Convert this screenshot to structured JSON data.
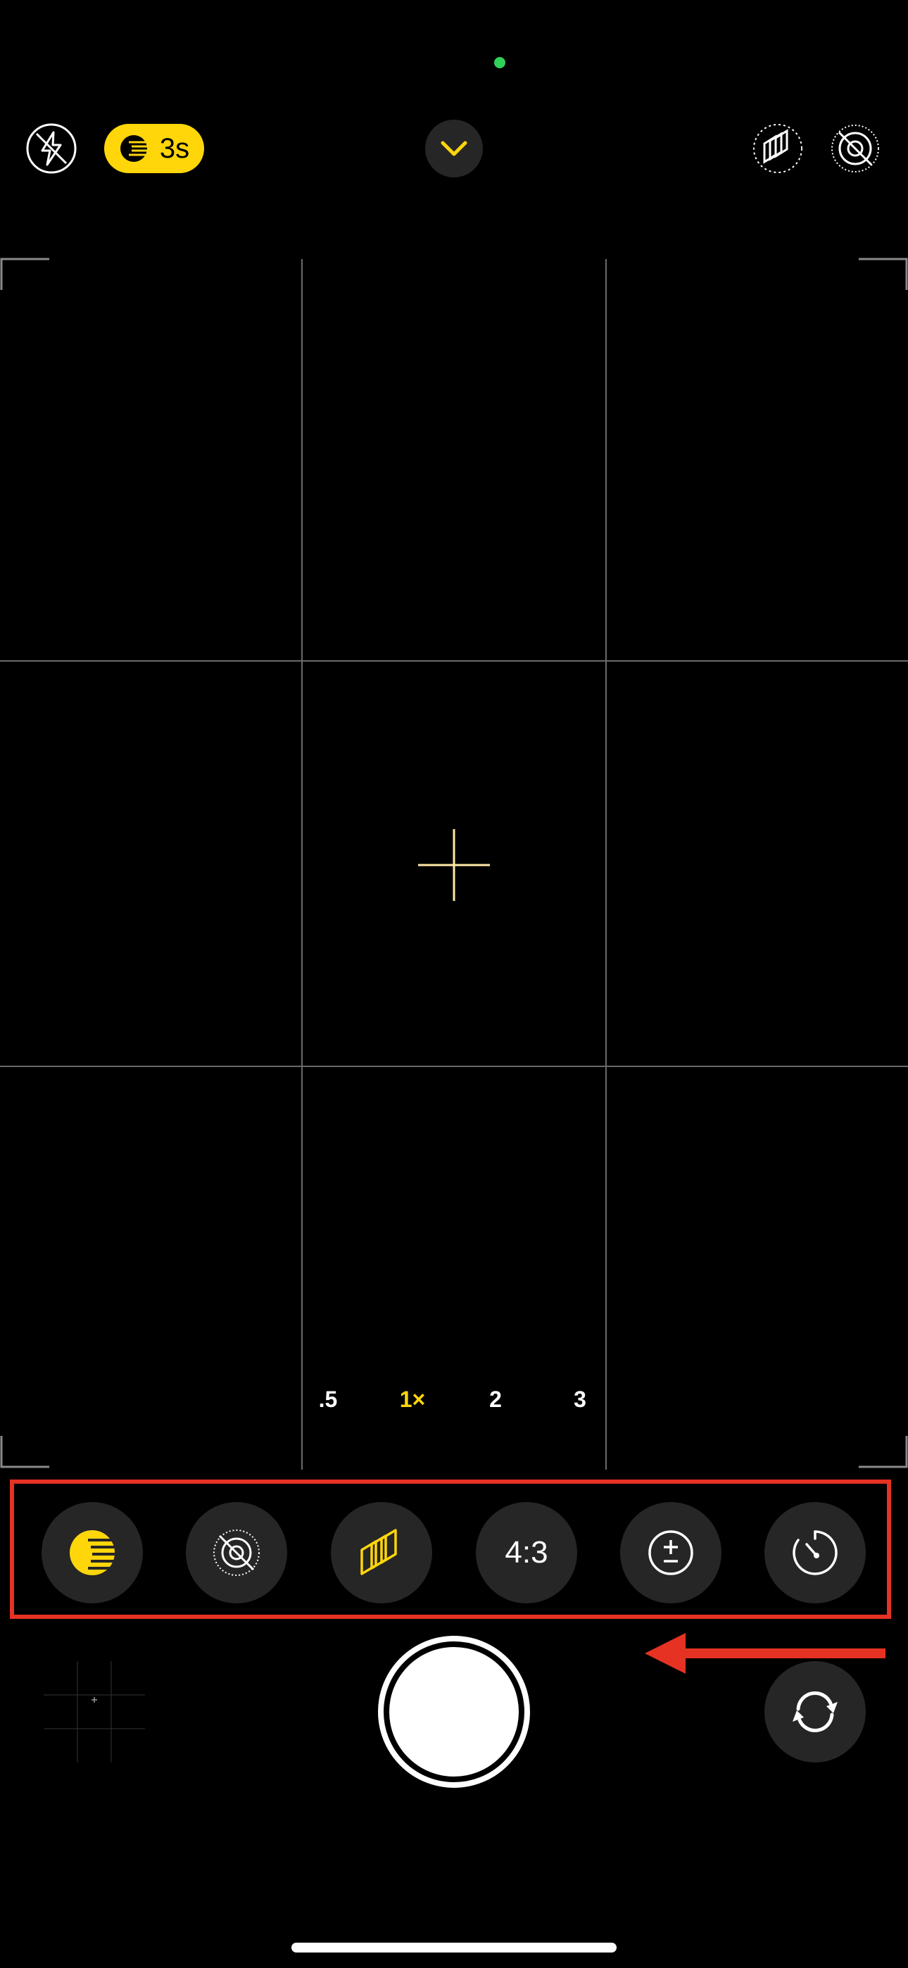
{
  "status": {
    "indicator_color": "#30d158"
  },
  "top_bar": {
    "flash_icon": "flash-off-icon",
    "night_mode": {
      "icon": "moon-icon",
      "label": "3s",
      "color": "#ffd60a"
    },
    "expand_icon": "chevron-down-icon",
    "live_photo_icon": "live-photo-icon",
    "styles_icon": "photographic-styles-icon"
  },
  "viewfinder": {
    "grid": "on",
    "focus_icon": "crosshair-icon",
    "zoom_levels": [
      ".5",
      "1×",
      "2",
      "3"
    ],
    "active_zoom": "1×"
  },
  "controls_tray": {
    "highlight_color": "#e53223",
    "buttons": [
      {
        "name": "night-mode-button",
        "icon": "moon-icon"
      },
      {
        "name": "live-photo-button",
        "icon": "live-photo-off-icon"
      },
      {
        "name": "styles-button",
        "icon": "photographic-styles-icon"
      },
      {
        "name": "aspect-ratio-button",
        "label": "4:3"
      },
      {
        "name": "exposure-button",
        "icon": "exposure-icon"
      },
      {
        "name": "timer-button",
        "icon": "timer-icon"
      }
    ]
  },
  "bottom": {
    "shutter_icon": "shutter-icon",
    "flip_icon": "camera-flip-icon",
    "thumbnail": "photo-thumbnail",
    "arrow_color": "#e53223"
  }
}
